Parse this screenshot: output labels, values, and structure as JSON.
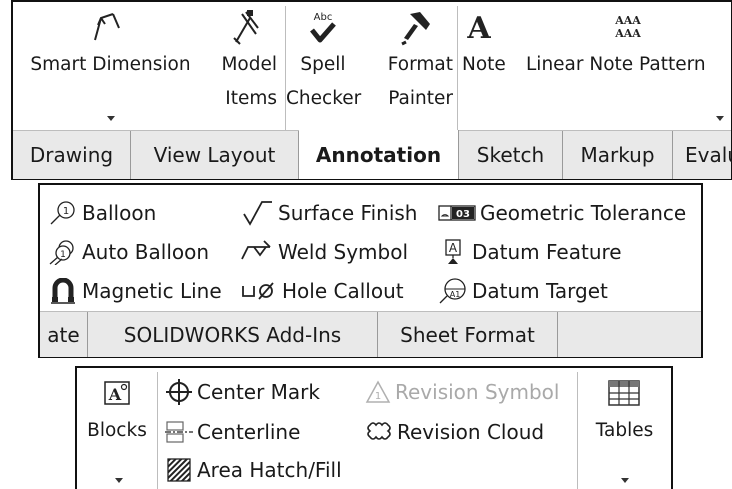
{
  "panel1": {
    "buttons": [
      {
        "line1": "Smart Dimension",
        "line2": "",
        "dropdown": true
      },
      {
        "line1": "Model",
        "line2": "Items",
        "dropdown": false
      },
      {
        "line1": "Spell",
        "line2": "Checker",
        "dropdown": false
      },
      {
        "line1": "Format",
        "line2": "Painter",
        "dropdown": false
      },
      {
        "line1": "Note",
        "line2": "",
        "dropdown": false
      },
      {
        "line1": "Linear Note Pattern",
        "line2": "",
        "dropdown": true
      }
    ],
    "icons": {
      "spell_abc": "Abc",
      "note_glyph": "A",
      "pattern_glyph": "AAA"
    },
    "tabs": [
      "Drawing",
      "View Layout",
      "Annotation",
      "Sketch",
      "Markup",
      "Evalu"
    ],
    "active_tab": "Annotation"
  },
  "panel2": {
    "items": [
      {
        "label": "Balloon",
        "icon": "balloon-icon"
      },
      {
        "label": "Surface Finish",
        "icon": "surface-finish-icon"
      },
      {
        "label": "Geometric Tolerance",
        "icon": "geometric-tolerance-icon"
      },
      {
        "label": "Auto Balloon",
        "icon": "auto-balloon-icon"
      },
      {
        "label": "Weld Symbol",
        "icon": "weld-symbol-icon"
      },
      {
        "label": "Datum Feature",
        "icon": "datum-feature-icon"
      },
      {
        "label": "Magnetic Line",
        "icon": "magnetic-line-icon"
      },
      {
        "label": "Hole Callout",
        "icon": "hole-callout-icon"
      },
      {
        "label": "Datum Target",
        "icon": "datum-target-icon"
      }
    ],
    "icon_text": {
      "balloon": "1",
      "gtol": "03",
      "datum_a": "A",
      "target_a": "A1"
    },
    "tabs": [
      "ate",
      "SOLIDWORKS Add-Ins",
      "Sheet Format"
    ]
  },
  "panel3": {
    "blocks_label": "Blocks",
    "tables_label": "Tables",
    "items": [
      {
        "label": "Center Mark",
        "icon": "center-mark-icon",
        "disabled": false
      },
      {
        "label": "Revision Symbol",
        "icon": "revision-symbol-icon",
        "disabled": true
      },
      {
        "label": "Centerline",
        "icon": "centerline-icon",
        "disabled": false
      },
      {
        "label": "Revision Cloud",
        "icon": "revision-cloud-icon",
        "disabled": false
      },
      {
        "label": "Area Hatch/Fill",
        "icon": "area-hatch-icon",
        "disabled": false
      }
    ],
    "icon_text": {
      "blocks_a": "A",
      "revision_1": "1"
    }
  }
}
